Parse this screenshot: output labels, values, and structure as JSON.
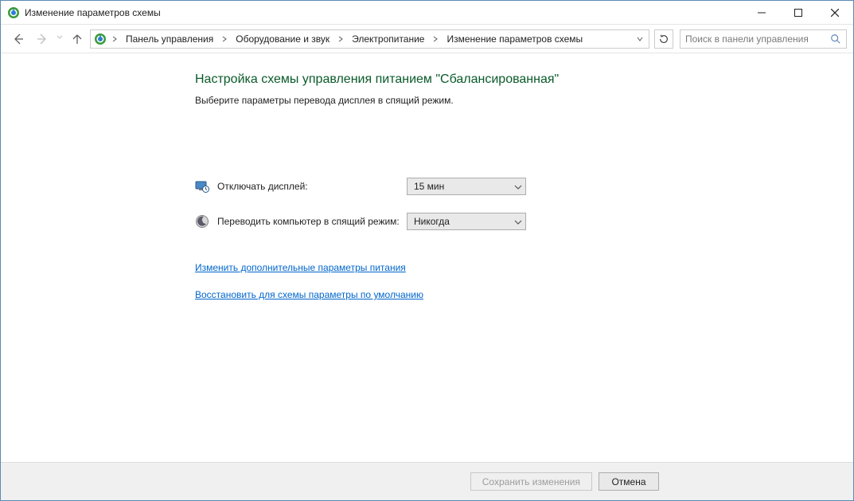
{
  "window": {
    "title": "Изменение параметров схемы"
  },
  "breadcrumb": {
    "items": [
      {
        "label": "Панель управления"
      },
      {
        "label": "Оборудование и звук"
      },
      {
        "label": "Электропитание"
      },
      {
        "label": "Изменение параметров схемы"
      }
    ]
  },
  "search": {
    "placeholder": "Поиск в панели управления"
  },
  "page": {
    "heading": "Настройка схемы управления питанием \"Сбалансированная\"",
    "subtext": "Выберите параметры перевода дисплея в спящий режим."
  },
  "settings": {
    "display_off": {
      "label": "Отключать дисплей:",
      "value": "15 мин"
    },
    "sleep": {
      "label": "Переводить компьютер в спящий режим:",
      "value": "Никогда"
    }
  },
  "links": {
    "advanced": "Изменить дополнительные параметры питания",
    "restore": "Восстановить для схемы параметры по умолчанию"
  },
  "buttons": {
    "save": "Сохранить изменения",
    "cancel": "Отмена"
  }
}
